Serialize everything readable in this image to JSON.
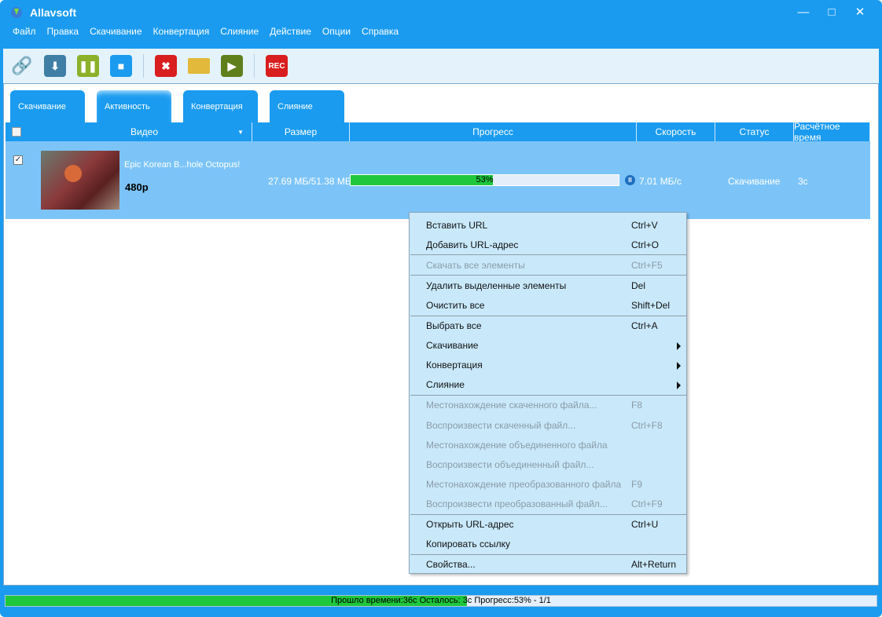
{
  "app": {
    "title": "Allavsoft",
    "window_controls": [
      "minimize",
      "maximize",
      "close"
    ]
  },
  "menu": [
    "Файл",
    "Правка",
    "Скачивание",
    "Конвертация",
    "Слияние",
    "Действие",
    "Опции",
    "Справка"
  ],
  "toolbar": [
    {
      "icon": "add-link-icon",
      "color": "#7a8a96"
    },
    {
      "icon": "download-icon",
      "color": "#3f7fa6"
    },
    {
      "icon": "pause-icon",
      "color": "#8cb02a"
    },
    {
      "icon": "stop-icon",
      "color": "#1a9bf0"
    },
    {
      "icon": "delete-icon",
      "color": "#d81e1e"
    },
    {
      "icon": "folder-icon",
      "color": "#e2b93b"
    },
    {
      "icon": "play-icon",
      "color": "#5f7f1c"
    },
    {
      "icon": "rec-icon",
      "color": "#d81e1e",
      "label": "REC"
    }
  ],
  "tabs": [
    "Скачивание",
    "Активность",
    "Конвертация",
    "Слияние"
  ],
  "active_tab": "Активность",
  "columns": [
    "Видео",
    "Размер",
    "Прогресс",
    "Скорость",
    "Статус",
    "Расчётное время"
  ],
  "row": {
    "checked": true,
    "title": "Epic Korean B...hole Octopus!",
    "quality": "480p",
    "size": "27.69 МБ/51.38 МБ",
    "progress_percent": 53,
    "progress_label": "53%",
    "speed": "7.01 МБ/с",
    "status": "Скачивание",
    "eta": "3с"
  },
  "context_menu": [
    {
      "label": "Вставить URL",
      "shortcut": "Ctrl+V"
    },
    {
      "label": "Добавить URL-адрес",
      "shortcut": "Ctrl+O"
    },
    {
      "label": "Скачать все элементы",
      "shortcut": "Ctrl+F5",
      "disabled": true,
      "sep_before": true
    },
    {
      "label": "Удалить выделенные элементы",
      "shortcut": "Del",
      "sep_before": true
    },
    {
      "label": "Очистить все",
      "shortcut": "Shift+Del"
    },
    {
      "label": "Выбрать все",
      "shortcut": "Ctrl+A",
      "sep_before": true
    },
    {
      "label": "Скачивание",
      "submenu": true
    },
    {
      "label": "Конвертация",
      "submenu": true
    },
    {
      "label": "Слияние",
      "submenu": true
    },
    {
      "label": "Местонахождение скаченного файла...",
      "shortcut": "F8",
      "disabled": true,
      "sep_before": true
    },
    {
      "label": "Воспроизвести скаченный файл...",
      "shortcut": "Ctrl+F8",
      "disabled": true
    },
    {
      "label": "Местонахождение объединенного файла",
      "disabled": true
    },
    {
      "label": "Воспроизвести объединенный файл...",
      "disabled": true
    },
    {
      "label": "Местонахождение преобразованного файла",
      "shortcut": "F9",
      "disabled": true
    },
    {
      "label": "Воспроизвести преобразованный файл...",
      "shortcut": "Ctrl+F9",
      "disabled": true
    },
    {
      "label": "Открыть URL-адрес",
      "shortcut": "Ctrl+U",
      "sep_before": true
    },
    {
      "label": "Копировать ссылку"
    },
    {
      "label": "Свойства...",
      "shortcut": "Alt+Return",
      "sep_before": true
    }
  ],
  "statusbar": {
    "text": "Прошло времени:36с Осталось: 3с Прогресс:53% - 1/1",
    "progress_percent": 53
  },
  "colors": {
    "accent": "#1a9bf0",
    "progress": "#1ec73c",
    "row_selected": "#7cc4f8",
    "menu_bg": "#c9e9fb"
  }
}
